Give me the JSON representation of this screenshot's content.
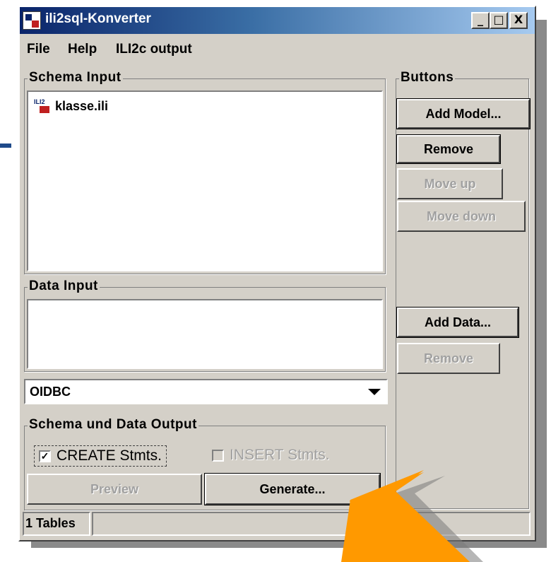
{
  "window": {
    "title": "ili2sql-Konverter",
    "controls": {
      "minimize": "_",
      "maximize": "□",
      "close": "X"
    }
  },
  "menu": [
    {
      "label": "File",
      "underline": "F"
    },
    {
      "label": "Help",
      "underline": "H"
    },
    {
      "label": "ILI2c output",
      "underline": "I"
    }
  ],
  "schema_input": {
    "label": "Schema Input",
    "items": [
      {
        "name": "klasse.ili",
        "icon": "ili-file-icon"
      }
    ]
  },
  "data_input": {
    "label": "Data Input",
    "items": []
  },
  "buttons": {
    "label": "Buttons",
    "add_model": "Add Model...",
    "remove_model": "Remove",
    "move_up": "Move up",
    "move_down": "Move down",
    "add_data": "Add Data...",
    "remove_data": "Remove"
  },
  "driver_select": {
    "value": "OIDBC"
  },
  "output": {
    "label": "Schema und Data Output",
    "create_stmts": {
      "label": "CREATE Stmts.",
      "checked": true
    },
    "insert_stmts": {
      "label": "INSERT Stmts.",
      "checked": false,
      "enabled": false
    },
    "preview": "Preview",
    "generate": "Generate..."
  },
  "status": {
    "tables": "1 Tables"
  },
  "colors": {
    "window_bg": "#d4d0c8",
    "title_start": "#0a246a",
    "title_end": "#a6caf0",
    "arrow": "#ff9900"
  }
}
